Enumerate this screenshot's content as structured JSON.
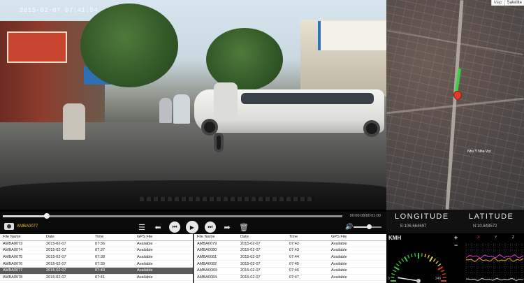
{
  "video": {
    "timestamp": "2015-02-07 07:41:54"
  },
  "map": {
    "type_options": [
      "Map",
      "Satellite"
    ],
    "street_label": "Nhu Ý Nhu Vọt"
  },
  "coords": {
    "longitude_label": "LONGITUDE",
    "latitude_label": "LATITUDE",
    "longitude_value": "E:106.664697",
    "latitude_value": "N:10.848572"
  },
  "player": {
    "progress_fraction": 0.13,
    "timecode": "00:00:08/00:01:00",
    "current_file": "AMBA0077",
    "volume_fraction": 0.55
  },
  "table_headers": [
    "File Name",
    "Date",
    "Time",
    "GPS File"
  ],
  "files_left": [
    {
      "name": "AMBA0073",
      "date": "2015-02-07",
      "time": "07:36",
      "gps": "Available"
    },
    {
      "name": "AMBA0074",
      "date": "2015-02-07",
      "time": "07:37",
      "gps": "Available"
    },
    {
      "name": "AMBA0075",
      "date": "2015-02-07",
      "time": "07:38",
      "gps": "Available"
    },
    {
      "name": "AMBA0076",
      "date": "2015-02-07",
      "time": "07:39",
      "gps": "Available"
    },
    {
      "name": "AMBA0077",
      "date": "2015-02-07",
      "time": "07:40",
      "gps": "Available"
    },
    {
      "name": "AMBA0078",
      "date": "2015-02-07",
      "time": "07:41",
      "gps": "Available"
    }
  ],
  "selected_index": 4,
  "files_right": [
    {
      "name": "AMBA0079",
      "date": "2015-02-07",
      "time": "07:42",
      "gps": "Available"
    },
    {
      "name": "AMBA0080",
      "date": "2015-02-07",
      "time": "07:43",
      "gps": "Available"
    },
    {
      "name": "AMBA0081",
      "date": "2015-02-07",
      "time": "07:44",
      "gps": "Available"
    },
    {
      "name": "AMBA0082",
      "date": "2015-02-07",
      "time": "07:45",
      "gps": "Available"
    },
    {
      "name": "AMBA0083",
      "date": "2015-02-07",
      "time": "07:46",
      "gps": "Available"
    },
    {
      "name": "AMBA0084",
      "date": "2015-02-07",
      "time": "07:47",
      "gps": "Available"
    }
  ],
  "speed": {
    "unit_label": "KMH",
    "min_label": "0",
    "max_label": "240",
    "needle_fraction": 0.05
  },
  "graph": {
    "zoom_in_label": "+",
    "zoom_out_label": "−",
    "legend": [
      {
        "label": "X",
        "color": "#d23bd2"
      },
      {
        "label": "Y",
        "color": "#f2a81d"
      },
      {
        "label": "Z",
        "color": "#e0e0e0"
      }
    ]
  },
  "colors": {
    "gps_trail": "#3ad143",
    "map_pin": "#e23b2e",
    "current_file": "#e0c030",
    "gauge_green": "#3cc63c",
    "gauge_yellow": "#e8d23a",
    "gauge_red": "#e23b2e"
  }
}
